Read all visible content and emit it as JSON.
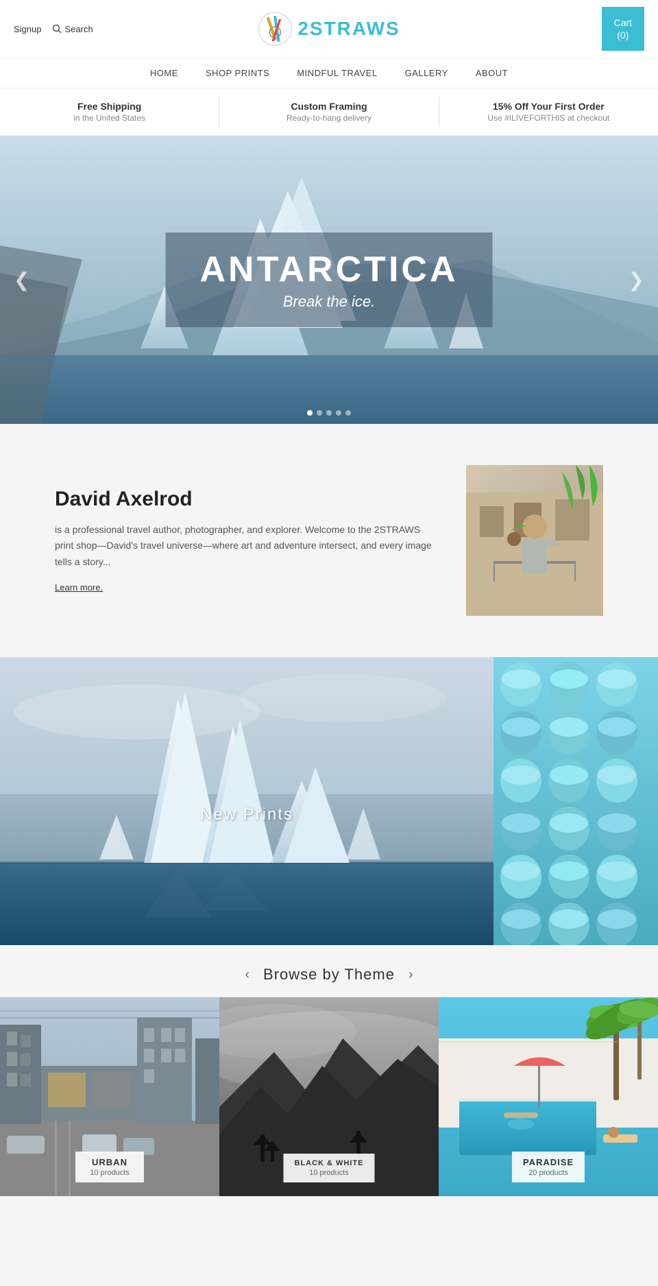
{
  "header": {
    "signup_label": "Signup",
    "search_label": "Search",
    "cart_label": "Cart",
    "cart_count": "(0)",
    "logo_text": "2STRAWS"
  },
  "nav": {
    "items": [
      {
        "label": "HOME",
        "href": "#"
      },
      {
        "label": "SHOP PRINTS",
        "href": "#"
      },
      {
        "label": "MINDFUL TRAVEL",
        "href": "#"
      },
      {
        "label": "GALLERY",
        "href": "#"
      },
      {
        "label": "ABOUT",
        "href": "#"
      }
    ]
  },
  "info_bar": {
    "items": [
      {
        "title": "Free Shipping",
        "subtitle": "in the United States"
      },
      {
        "title": "Custom Framing",
        "subtitle": "Ready-to-hang delivery"
      },
      {
        "title": "15% Off Your First Order",
        "subtitle": "Use #ILIVEFORTHIS at checkout"
      }
    ]
  },
  "hero": {
    "title": "ANTARCTICA",
    "subtitle": "Break the ice.",
    "dots": 5
  },
  "about": {
    "name": "David Axelrod",
    "description": "is a professional travel author, photographer, and explorer. Welcome to the 2STRAWS print shop—David's travel universe—where art and adventure intersect, and every image tells a story...",
    "link_label": "Learn more."
  },
  "collections": {
    "main_label": "New Prints",
    "side_label": ""
  },
  "browse": {
    "title": "Browse by Theme",
    "themes": [
      {
        "name": "URBAN",
        "count": "10 products"
      },
      {
        "name": "BLACK & WHITE",
        "count": "10 products"
      },
      {
        "name": "PARADISE",
        "count": "20 products"
      }
    ]
  }
}
